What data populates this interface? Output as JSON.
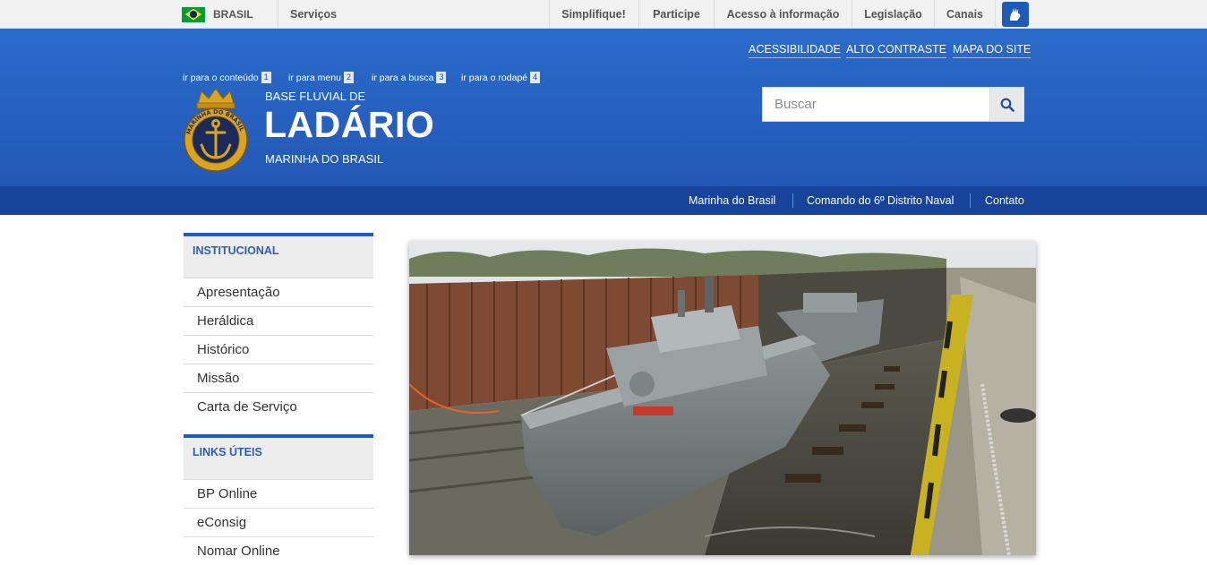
{
  "govbar": {
    "country": "BRASIL",
    "services": "Serviços",
    "links": [
      "Simplifique!",
      "Participe",
      "Acesso à informação",
      "Legislação",
      "Canais"
    ]
  },
  "skip_links": [
    {
      "label": "ir para o conteúdo",
      "num": "1"
    },
    {
      "label": "ir para menu",
      "num": "2"
    },
    {
      "label": "ir para a busca",
      "num": "3"
    },
    {
      "label": "ir para o rodapé",
      "num": "4"
    }
  ],
  "accessibility": [
    "ACESSIBILIDADE",
    "ALTO CONTRASTE",
    "MAPA DO SITE"
  ],
  "site": {
    "prefix": "BASE FLUVIAL DE",
    "title": "LADÁRIO",
    "subtitle": "MARINHA DO BRASIL",
    "logo_text": "MARINHA DO BRASIL"
  },
  "search": {
    "placeholder": "Buscar"
  },
  "subnav": [
    "Marinha do Brasil",
    "Comando do 6º Distrito Naval",
    "Contato"
  ],
  "sidebar": {
    "institucional": {
      "title": "INSTITUCIONAL",
      "items": [
        "Apresentação",
        "Heráldica",
        "Histórico",
        "Missão",
        "Carta de Serviço"
      ]
    },
    "links": {
      "title": "LINKS ÚTEIS",
      "items": [
        "BP Online",
        "eConsig",
        "Nomar Online"
      ]
    }
  },
  "colors": {
    "header_blue": "#2a6bc9",
    "nav_dark_blue": "#17439b",
    "accent_blue": "#1f5ac5",
    "logo_gold": "#d9a520",
    "logo_navy": "#1b2a5a"
  },
  "icons": [
    "brazil-flag-icon",
    "accessibility-hands-icon",
    "search-icon"
  ]
}
